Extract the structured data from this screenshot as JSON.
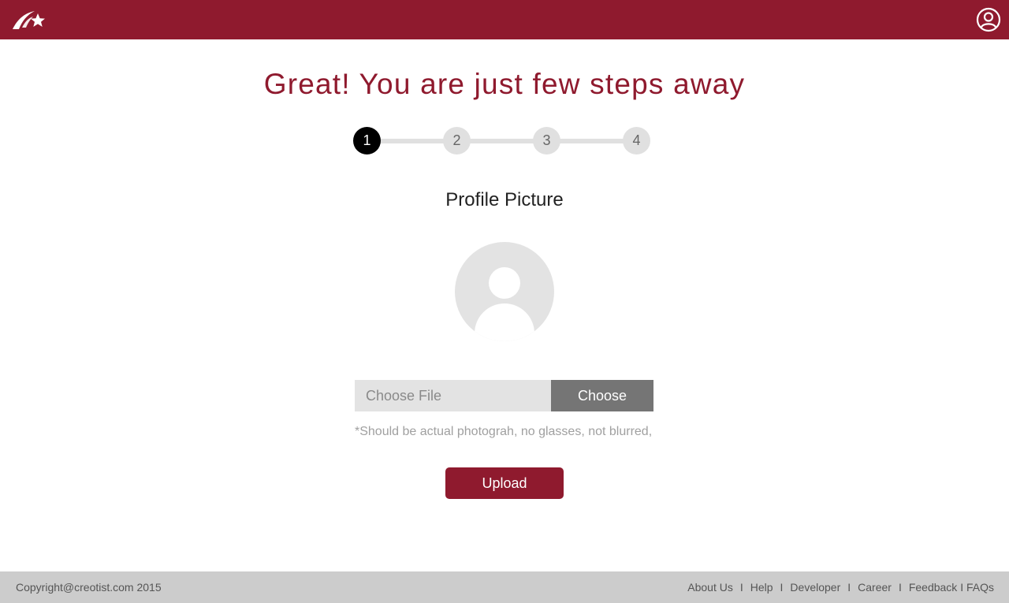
{
  "header": {
    "logo_icon": "brand-star-swoosh-icon",
    "account_icon": "user-circle-icon",
    "brand_color": "#8f1a2e"
  },
  "main": {
    "headline": "Great! You are just few steps away",
    "steps": [
      {
        "label": "1",
        "active": true
      },
      {
        "label": "2",
        "active": false
      },
      {
        "label": "3",
        "active": false
      },
      {
        "label": "4",
        "active": false
      }
    ],
    "section_title": "Profile Picture",
    "avatar_icon": "default-avatar-icon",
    "file": {
      "placeholder": "Choose File",
      "value": "",
      "choose_label": "Choose"
    },
    "hint": "*Should be actual photograh, no glasses, not blurred,",
    "upload_label": "Upload"
  },
  "footer": {
    "copyright": "Copyright@creotist.com 2015",
    "separator": "I",
    "links": [
      "About Us",
      "Help",
      "Developer",
      "Career",
      "Feedback I FAQs"
    ]
  }
}
